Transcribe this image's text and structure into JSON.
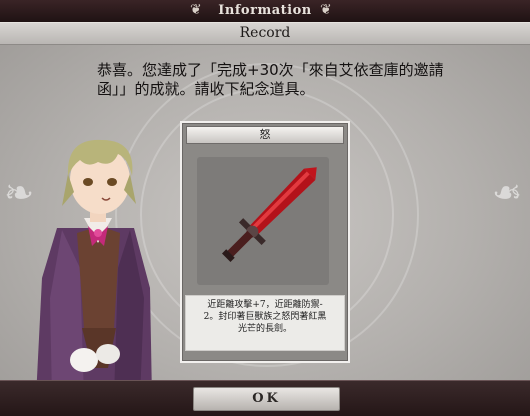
{
  "header": {
    "title": "Information"
  },
  "subheader": {
    "label": "Record"
  },
  "message": {
    "line1": "恭喜。您達成了「完成+30次「來自艾依查庫的邀請",
    "line2": "函」」的成就。請收下紀念道具。"
  },
  "reward_card": {
    "title": "怒",
    "item_icon": "red-sword-icon",
    "description_lines": [
      "近距離攻擊+7，近距離防禦-",
      "2。封印著巨獸族之怒閃著紅黑",
      "光芒的長劍。"
    ]
  },
  "footer": {
    "ok_label": "OK"
  },
  "colors": {
    "sword_red": "#c0141c",
    "frame_dark": "#2a1a1c",
    "panel_grey": "#b3b0ad"
  }
}
